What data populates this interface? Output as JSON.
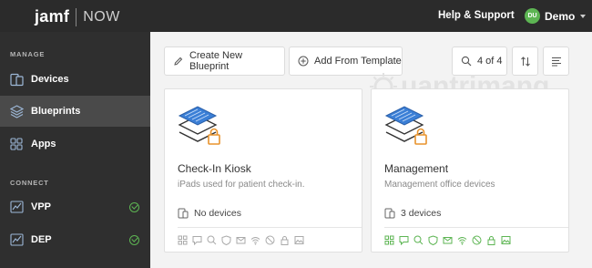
{
  "app": {
    "brand": "jamf",
    "product": "NOW"
  },
  "header": {
    "help_label": "Help & Support",
    "user_initials": "DU",
    "user_name": "Demo"
  },
  "sidebar": {
    "manage_label": "MANAGE",
    "connect_label": "CONNECT",
    "items": [
      {
        "label": "Devices",
        "icon": "devices-icon"
      },
      {
        "label": "Blueprints",
        "icon": "blueprints-icon",
        "active": true
      },
      {
        "label": "Apps",
        "icon": "apps-icon"
      },
      {
        "label": "VPP",
        "icon": "vpp-icon",
        "connected": true
      },
      {
        "label": "DEP",
        "icon": "dep-icon",
        "connected": true
      }
    ],
    "status_color": "#5db553"
  },
  "toolbar": {
    "create_label": "Create New Blueprint",
    "template_label": "Add From Template",
    "search_count": "4 of 4"
  },
  "cards": [
    {
      "title": "Check-In Kiosk",
      "description": "iPads used for patient check-in.",
      "devices": "No devices",
      "icons_active": false
    },
    {
      "title": "Management",
      "description": "Management office devices",
      "devices": "3 devices",
      "icons_active": true
    }
  ],
  "watermark": {
    "text": "uantrimang"
  },
  "colors": {
    "topbar": "#2b2b2b",
    "sidebar": "#2f2f2f",
    "accent_green": "#5db553",
    "lock_orange": "#e8932d",
    "blueprint_blue": "#3b7fd6"
  }
}
